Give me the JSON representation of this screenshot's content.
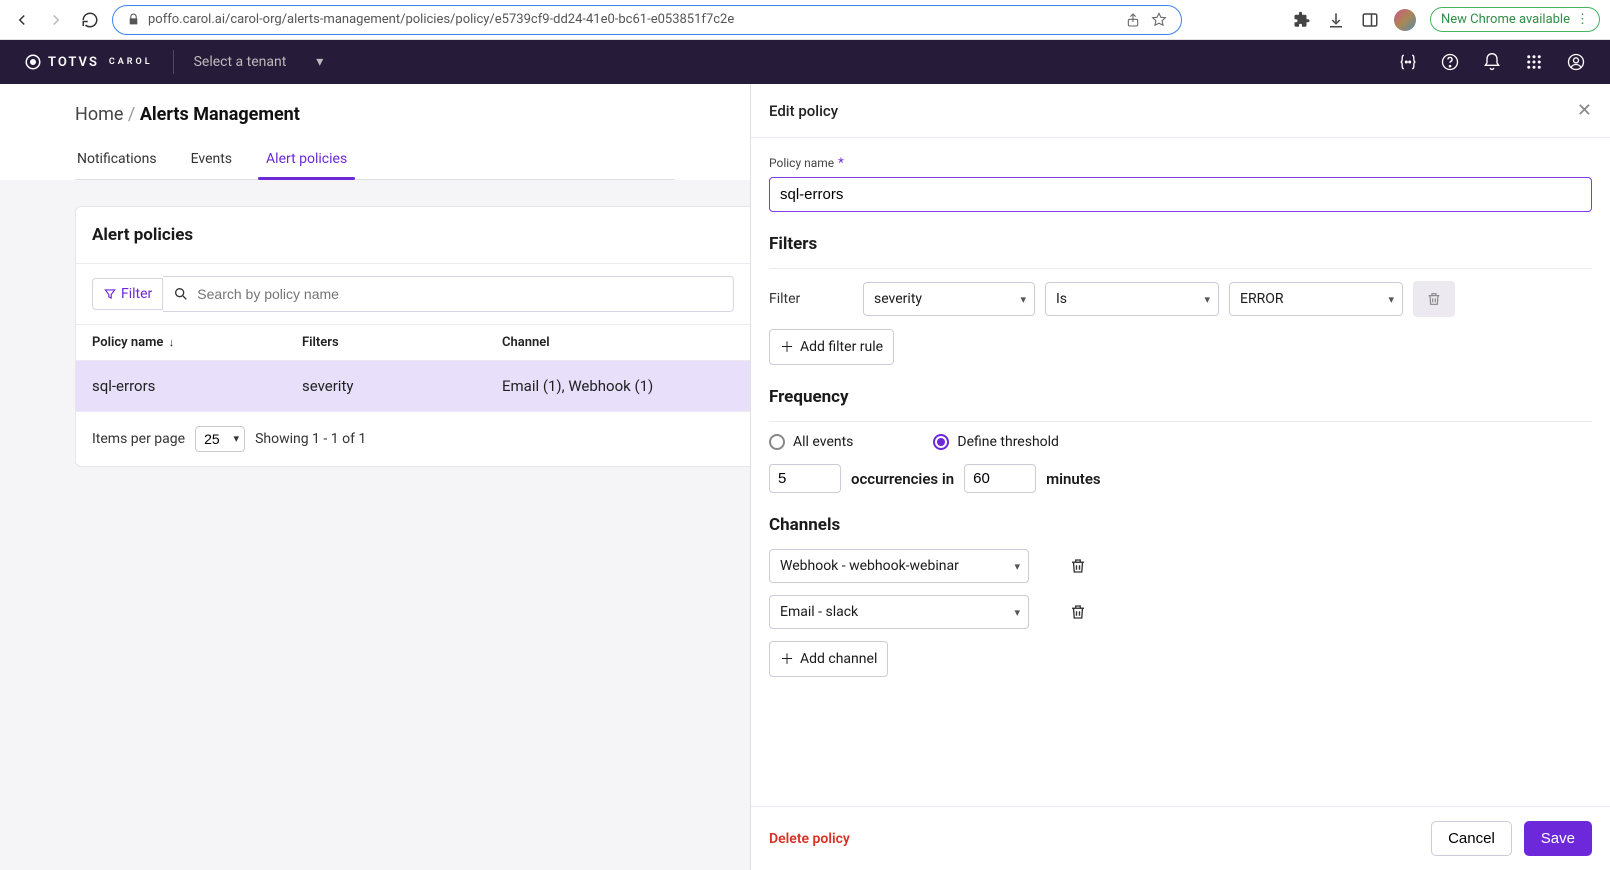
{
  "browser": {
    "url": "poffo.carol.ai/carol-org/alerts-management/policies/policy/e5739cf9-dd24-41e0-bc61-e053851f7c2e",
    "update_label": "New Chrome available"
  },
  "appbar": {
    "brand": "TOTVS",
    "brand_sub": "CAROL",
    "tenant_placeholder": "Select a tenant"
  },
  "breadcrumb": {
    "home": "Home",
    "sep": "/",
    "current": "Alerts Management"
  },
  "tabs": {
    "notifications": "Notifications",
    "events": "Events",
    "policies": "Alert policies"
  },
  "listCard": {
    "title": "Alert policies",
    "filter_label": "Filter",
    "search_placeholder": "Search by policy name",
    "cols": {
      "name": "Policy name",
      "filters": "Filters",
      "channel": "Channel"
    },
    "rows": [
      {
        "name": "sql-errors",
        "filters": "severity",
        "channel": "Email (1), Webhook (1)"
      }
    ],
    "pager": {
      "items_label": "Items per page",
      "size": "25",
      "showing": "Showing 1 - 1 of 1"
    }
  },
  "panel": {
    "title": "Edit policy",
    "policy_name_label": "Policy name",
    "policy_name_value": "sql-errors",
    "filters_title": "Filters",
    "filter_label": "Filter",
    "filter_field": "severity",
    "filter_op": "Is",
    "filter_value": "ERROR",
    "add_filter": "Add filter rule",
    "frequency_title": "Frequency",
    "freq_all": "All events",
    "freq_threshold": "Define threshold",
    "occ_value": "5",
    "occ_label": "occurrencies in",
    "min_value": "60",
    "min_label": "minutes",
    "channels_title": "Channels",
    "channel_1": "Webhook - webhook-webinar",
    "channel_2": "Email - slack",
    "add_channel": "Add channel",
    "delete": "Delete policy",
    "cancel": "Cancel",
    "save": "Save"
  }
}
